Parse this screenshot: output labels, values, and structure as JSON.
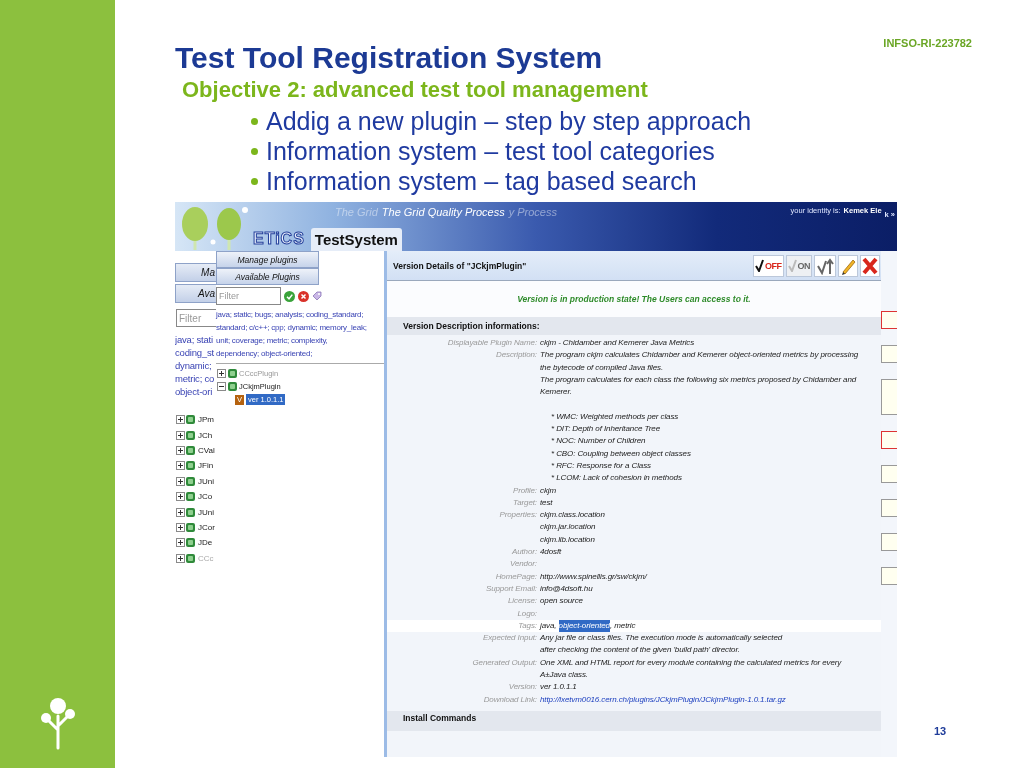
{
  "slide": {
    "code": "INFSO-RI-223782",
    "title": "Test Tool Registration System",
    "subtitle": "Objective 2: advanced test tool management",
    "bullets": [
      "Addig a new plugin – step by step approach",
      "Information system – test tool categories",
      "Information system – tag based search"
    ],
    "page_number": "13"
  },
  "banner": {
    "logo": "ETiCS",
    "slogans": [
      {
        "text": "The Grid",
        "faded": true
      },
      {
        "text": "The Grid Quality Process",
        "faded": false
      },
      {
        "text": "y Process",
        "faded": true
      }
    ],
    "identity_label": "your identity is:",
    "identity_user": "Kemek Ele",
    "identity_tail": "k »",
    "tab": {
      "label": "TestSystem",
      "selected": true
    }
  },
  "back_sidebar": {
    "buttons": [
      "Ma",
      "Ava"
    ],
    "filter": {
      "placeholder": "Filter"
    },
    "tags": [
      "java; stati",
      "coding_st",
      "dynamic;",
      "metric; co",
      "object-ori"
    ],
    "tree": [
      {
        "label": "JPm",
        "expanded": false,
        "disabled": false
      },
      {
        "label": "JCh",
        "expanded": false,
        "disabled": false
      },
      {
        "label": "CVal",
        "expanded": false,
        "disabled": false
      },
      {
        "label": "JFin",
        "expanded": false,
        "disabled": false
      },
      {
        "label": "JUni",
        "expanded": false,
        "disabled": false
      },
      {
        "label": "JCo",
        "expanded": false,
        "disabled": false
      },
      {
        "label": "JUni",
        "expanded": false,
        "disabled": false
      },
      {
        "label": "JCor",
        "expanded": false,
        "disabled": false
      },
      {
        "label": "JDe",
        "expanded": false,
        "disabled": false
      },
      {
        "label": "CCc",
        "expanded": false,
        "disabled": true
      }
    ]
  },
  "plugin_panel": {
    "buttons": [
      "Manage plugins",
      "Available Plugins"
    ],
    "filter": {
      "placeholder": "Filter"
    },
    "tags": [
      "java; static; bugs; analysis; coding_standard;",
      "standard; c/c++; cpp; dynamic; memory_leak;",
      "unit; coverage; metric; complexity,",
      "dependency; object-oriented;"
    ],
    "tree": [
      {
        "label": "CCccPlugin",
        "expanded": false,
        "disabled": true
      },
      {
        "label": "JCkjmPlugin",
        "expanded": true,
        "disabled": false,
        "children": [
          {
            "badge": "V",
            "label": "ver 1.0.1.1",
            "selected": true
          }
        ]
      }
    ]
  },
  "details": {
    "title": "Version Details of \"JCkjmPlugin\"",
    "actions": [
      {
        "kind": "off",
        "label": "OFF",
        "disabled": false
      },
      {
        "kind": "on",
        "label": "ON",
        "disabled": true
      },
      {
        "kind": "approve",
        "disabled": false
      },
      {
        "kind": "edit",
        "disabled": false
      },
      {
        "kind": "delete",
        "disabled": false
      }
    ],
    "status_message": "Version is in production state! The Users can access to it.",
    "section_title": "Version Description informations:",
    "fields": [
      {
        "label": "Displayable Plugin Name:",
        "highlighted": false,
        "lines": [
          "ckjm - Chidamber and Kemerer Java Metrics"
        ]
      },
      {
        "label": "Description:",
        "highlighted": false,
        "lines": [
          "The program ckjm calculates Chidamber and Kemerer object-oriented metrics by processing",
          "the bytecode of compiled Java files.",
          "The program calculates for each class the following six metrics proposed by Chidamber and",
          "Kemerer."
        ],
        "list": [
          "* WMC: Weighted methods per class",
          "* DIT: Depth of Inheritance Tree",
          "* NOC: Number of Children",
          "* CBO: Coupling between object classes",
          "* RFC: Response for a Class",
          "* LCOM: Lack of cohesion in methods"
        ]
      },
      {
        "label": "Profile:",
        "highlighted": false,
        "lines": [
          "ckjm"
        ]
      },
      {
        "label": "Target:",
        "highlighted": false,
        "lines": [
          "test"
        ]
      },
      {
        "label": "Properties:",
        "highlighted": false,
        "lines": [
          "ckjm.class.location",
          "ckjm.jar.location",
          "ckjm.lib.location"
        ]
      },
      {
        "label": "Author:",
        "highlighted": false,
        "lines": [
          "4dosft"
        ]
      },
      {
        "label": "Vendor:",
        "highlighted": false
      },
      {
        "label": "HomePage:",
        "highlighted": false,
        "lines": [
          "http://www.spinellis.gr/sw/ckjm/"
        ]
      },
      {
        "label": "Support Email:",
        "highlighted": false,
        "lines": [
          "info@4dsoft.hu"
        ]
      },
      {
        "label": "License:",
        "highlighted": false,
        "lines": [
          "open source"
        ]
      },
      {
        "label": "Logo:",
        "highlighted": false
      },
      {
        "label": "Tags:",
        "highlighted": true,
        "tags": [
          {
            "text": "java, ",
            "selected": false
          },
          {
            "text": "object-oriented",
            "selected": true
          },
          {
            "text": ", metric",
            "selected": false
          }
        ]
      },
      {
        "label": "Expected Input:",
        "highlighted": false,
        "lines": [
          "Any jar file or class files. The execution mode is automatically selected",
          "after checking the content of the given 'build path' director."
        ]
      },
      {
        "label": "Generated Output:",
        "highlighted": false,
        "lines": [
          "One XML and HTML report for every module containing the calculated metrics for every",
          "A±Java class."
        ]
      },
      {
        "label": "Version:",
        "highlighted": false,
        "lines": [
          "ver 1.0.1.1"
        ]
      },
      {
        "label": "Download Link:",
        "highlighted": false,
        "link": true,
        "lines": [
          "http://lxetvm0016.cern.ch/plugins/JCkjmPlugin/JCkjmPlugin-1.0.1.tar.gz"
        ]
      }
    ],
    "next_section_title": "Install Commands"
  },
  "side_fields": [
    {
      "kind": "input",
      "invalid": true
    },
    {
      "kind": "input",
      "invalid": false
    },
    {
      "kind": "textarea",
      "invalid": false
    },
    {
      "kind": "input",
      "invalid": true
    },
    {
      "kind": "input",
      "invalid": false
    },
    {
      "kind": "input",
      "invalid": false
    },
    {
      "kind": "input",
      "invalid": false
    },
    {
      "kind": "input",
      "invalid": false
    }
  ]
}
